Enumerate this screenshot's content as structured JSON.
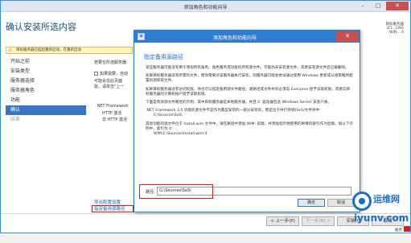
{
  "outer_window": {
    "title": "添加角色和功能向导",
    "heading": "确认安装所选内容",
    "destination": [
      "目标服务器",
      "iZ1...CNG",
      "WIN-...4"
    ],
    "warning": "目标服务器已挂起重新启动。在重新启动",
    "nav_items": [
      {
        "label": "开始之前",
        "state": "normal"
      },
      {
        "label": "安装类型",
        "state": "normal"
      },
      {
        "label": "服务器选择",
        "state": "normal"
      },
      {
        "label": "服务器角色",
        "state": "normal"
      },
      {
        "label": "功能",
        "state": "normal"
      },
      {
        "label": "确认",
        "state": "active"
      },
      {
        "label": "结果",
        "state": "disabled"
      }
    ],
    "main_lines": [
      "若要在所选服务器",
      "如果需要，自动",
      "可能会在此页面",
      "能，请单击\"上一",
      ".NET Framework",
      "HTTP 激活",
      "非 HTTP 激活"
    ],
    "links": [
      "导出配置设置",
      "指定备用源路径"
    ],
    "buttons": [
      "< 上一步(P)",
      "下一步(N) >",
      "安装(I)",
      "取消"
    ]
  },
  "dialog": {
    "title": "添加角色和功能向导",
    "heading": "指定备用源路径",
    "paragraphs": [
      "某些服务器可能没有用于添加所有角色、角色服务或功能的所有源文件。可能尚未安装源文件，或者安装源文件后已被删除。",
      "如果目标服务器没有所需的文件，而你需要对该服务器执行安装，则服务器可能会尝试通过使用 Windows 更新或从组策略所配置的源获取文件。",
      "如果目标服务器没有访问权限，你也可以指定备用源文件路径。源路径或文件共享必须向 Everyone 授予读取权限，或者向目标服务器的计算机帐户授予读取权限。",
      "下面是有效源文件路径的示例，其中目标服务器是本地服务器，并且 E: 驱动器包含 Windows Server 安装介质。",
      ".NET Framework 3.5 功能的源文件不是作为典型安装的一部分安装的，而是位于并行存储(SxS)文件夹中:",
      "其他功能的源文件位于 Install.wim 文件中。请在路径中添加 WIM: 前缀，并添加指示要使用的映像的索引作为后缀，如以下示例中，索引为 4:"
    ],
    "examples": [
      "E:\\Sources\\SxS\\",
      "WIM:E:\\Sources\\Install.wim:4"
    ],
    "path_label": "路径:",
    "path_value": "G:\\Sources\\SxS\\",
    "buttons": [
      "确定",
      "取消"
    ]
  },
  "watermark": {
    "cn": "运维网",
    "en": "iyunv.com"
  },
  "taskbar_label": "服务",
  "colors": {
    "accent": "#2f7dd1",
    "highlight": "#d62020",
    "nav_active": "#3a76c4"
  }
}
